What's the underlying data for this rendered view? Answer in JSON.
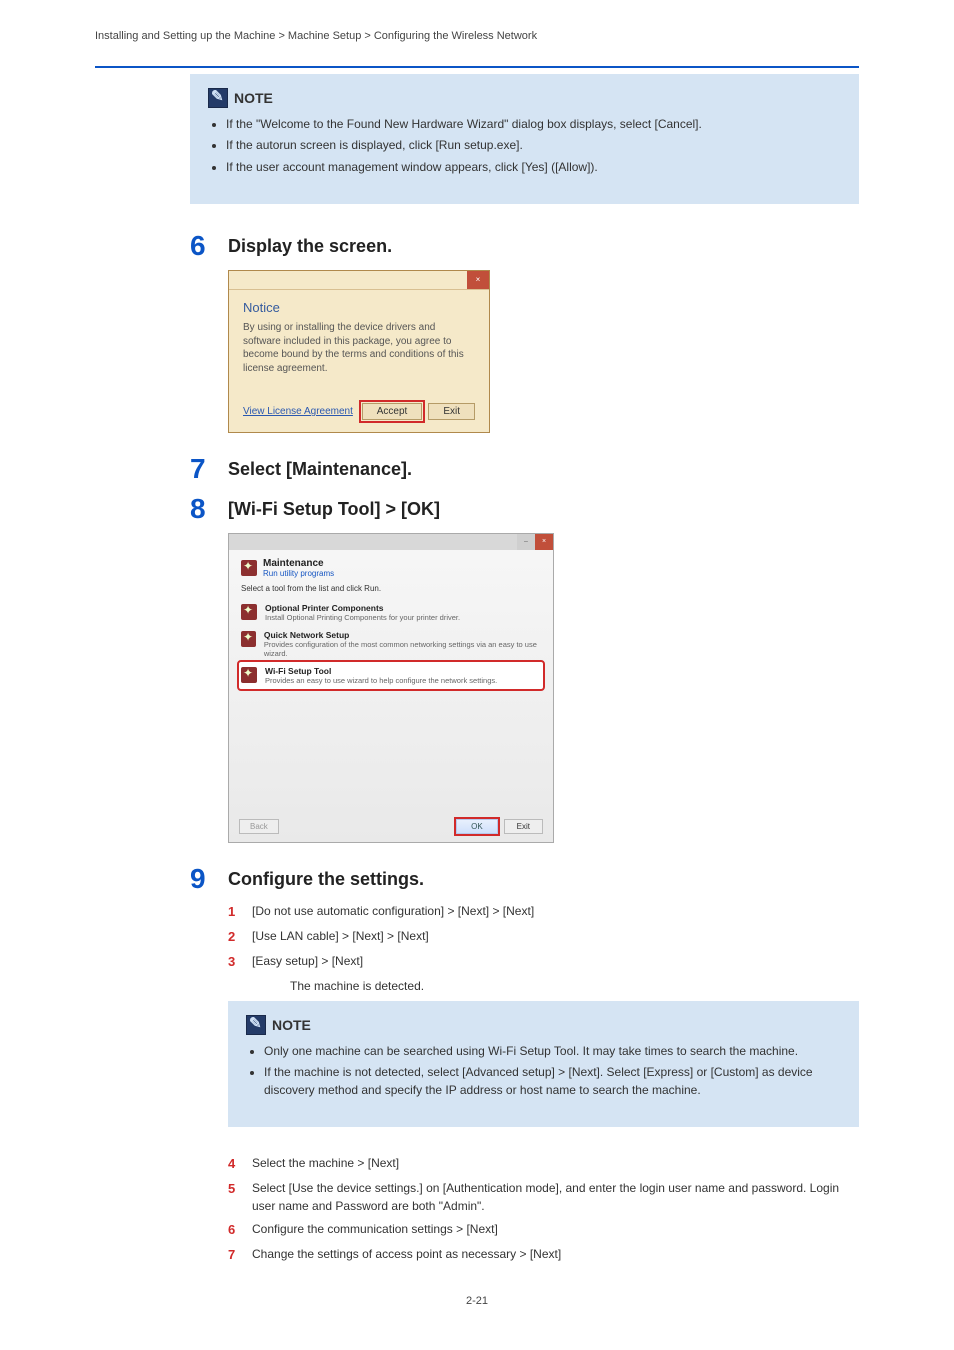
{
  "header": {
    "left": "Installing and Setting up the Machine > Machine Setup > Configuring the Wireless Network",
    "right": ""
  },
  "note": {
    "label": "NOTE",
    "line1": "If the \"Welcome to the Found New Hardware Wizard\" dialog box displays, select [Cancel].",
    "line2": "If the autorun screen is displayed, click [Run setup.exe].",
    "line3_a": "If the user account management window appears, click [Yes] ([Allow])."
  },
  "step6": {
    "num": "6",
    "title": "Display the screen.",
    "dialog": {
      "titlebar": "",
      "close": "×",
      "heading": "Notice",
      "text": "By using or installing the device drivers and software included in this package, you agree to become bound by the terms and conditions of this license agreement.",
      "link": "View License Agreement",
      "accept": "Accept",
      "exit": "Exit"
    }
  },
  "step7": {
    "num": "7",
    "title": "Select [Maintenance]."
  },
  "step8": {
    "num": "8",
    "title": "[Wi-Fi Setup Tool] > [OK]",
    "dialog": {
      "close": "×",
      "min": "–",
      "head_bold": "Maintenance",
      "head_sub": "Run utility programs",
      "instr": "Select a tool from the list and click Run.",
      "item1_b": "Optional Printer Components",
      "item1_s": "Install Optional Printing Components for your printer driver.",
      "item2_b": "Quick Network Setup",
      "item2_s": "Provides configuration of the most common networking settings via an easy to use wizard.",
      "item3_b": "Wi-Fi Setup Tool",
      "item3_s": "Provides an easy to use wizard to help configure the network settings.",
      "back": "Back",
      "ok": "OK",
      "exit": "Exit"
    }
  },
  "step9": {
    "num": "9",
    "title": "Configure the settings.",
    "s1": "[Do not use automatic configuration] > [Next] > [Next]",
    "s2": "[Use LAN cable] > [Next] > [Next]",
    "s3": "[Easy setup] > [Next]",
    "s3_after": "The machine is detected.",
    "s4": "Select the machine > [Next]",
    "s5": "Select [Use the device settings.] on [Authentication mode], and enter the login user name and password. Login user name and Password are both \"Admin\".",
    "s6": "Configure the communication settings > [Next]",
    "s7": "Change the settings of access point as necessary > [Next]"
  },
  "notes_block": {
    "line1": "Only one machine can be searched using Wi-Fi Setup Tool. It may take times to search the machine.",
    "line2": "If the machine is not detected, select [Advanced setup] > [Next]. Select [Express] or [Custom] as device discovery method and specify the IP address or host name to search the machine."
  },
  "pagenum": "2-21"
}
